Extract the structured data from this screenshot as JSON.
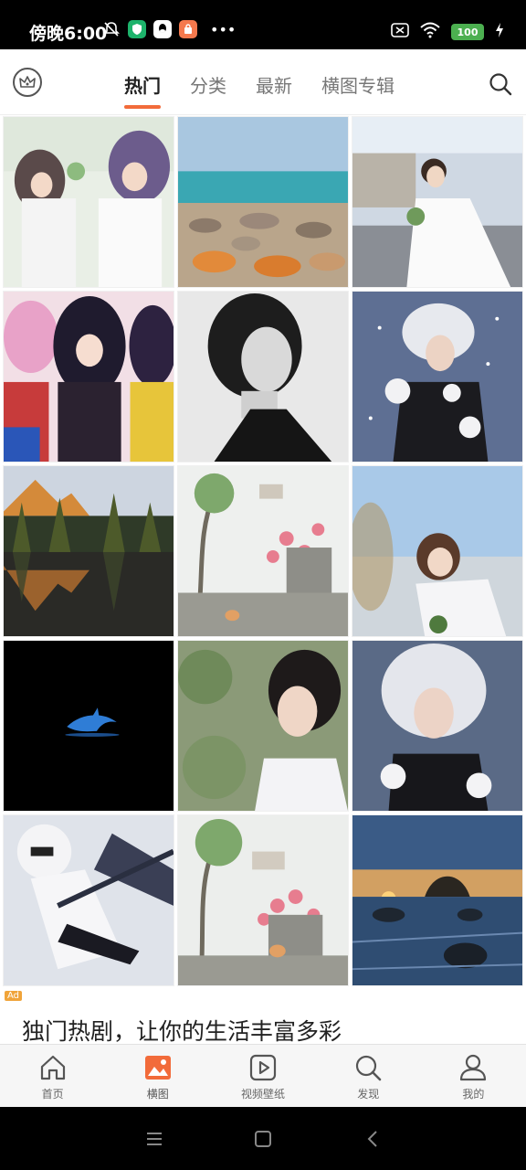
{
  "status": {
    "time": "傍晚6:00",
    "more": "•••",
    "battery": "100"
  },
  "tabs": [
    {
      "label": "热门",
      "active": true
    },
    {
      "label": "分类",
      "active": false
    },
    {
      "label": "最新",
      "active": false
    },
    {
      "label": "横图专辑",
      "active": false
    }
  ],
  "grid": {
    "tiles": [
      {
        "subject": "anime girls in white dresses",
        "icon": "anime-image"
      },
      {
        "subject": "rocky seashore",
        "icon": "seascape-image"
      },
      {
        "subject": "woman in white dress on street",
        "icon": "portrait-image"
      },
      {
        "subject": "anime characters",
        "icon": "anime-image"
      },
      {
        "subject": "black and white portrait",
        "icon": "portrait-image"
      },
      {
        "subject": "woman in fur hat with snow",
        "icon": "portrait-image"
      },
      {
        "subject": "autumn forest reflection lake",
        "icon": "landscape-image"
      },
      {
        "subject": "courtyard wall with flowers and cat",
        "icon": "garden-image"
      },
      {
        "subject": "woman smiling outdoors",
        "icon": "portrait-image"
      },
      {
        "subject": "dolphin on black",
        "icon": "dolphin-image"
      },
      {
        "subject": "woman among leaves",
        "icon": "portrait-image"
      },
      {
        "subject": "woman in white fur hat",
        "icon": "portrait-image"
      },
      {
        "subject": "anime girl with sword",
        "icon": "anime-image"
      },
      {
        "subject": "courtyard wall with flowers and cat",
        "icon": "garden-image"
      },
      {
        "subject": "sunset over rocky water",
        "icon": "sunset-image"
      }
    ]
  },
  "ad": {
    "badge": "Ad",
    "text": "独门热剧，让你的生活丰富多彩"
  },
  "bottom_nav": [
    {
      "label": "首页",
      "icon": "home-icon",
      "active": false
    },
    {
      "label": "横图",
      "icon": "image-icon",
      "active": true
    },
    {
      "label": "视频壁纸",
      "icon": "video-icon",
      "active": false
    },
    {
      "label": "发现",
      "icon": "discover-icon",
      "active": false
    },
    {
      "label": "我的",
      "icon": "profile-icon",
      "active": false
    }
  ],
  "colors": {
    "accent": "#f26b3a"
  }
}
